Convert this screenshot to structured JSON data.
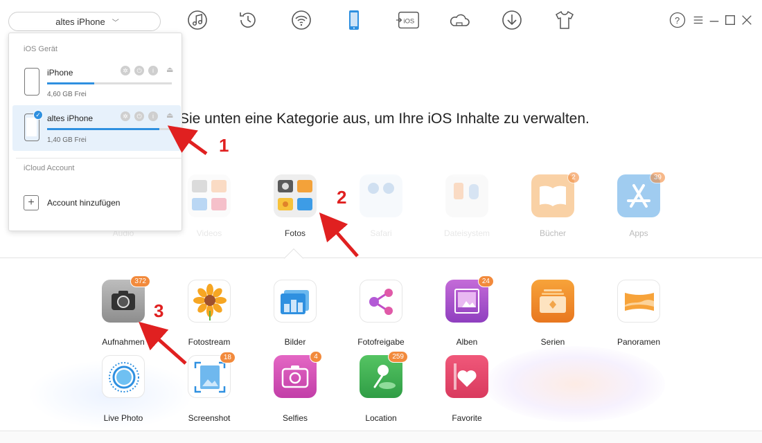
{
  "toolbar": {
    "device_label": "altes iPhone",
    "tools": [
      "music-icon",
      "history-icon",
      "wifi-icon",
      "phone-icon",
      "ios-icon",
      "cloud-icon",
      "download-icon",
      "tshirt-icon"
    ],
    "ios_label": "iOS",
    "active_tool_color": "#2f90e0",
    "help_label": "?"
  },
  "headline": "Sie unten eine Kategorie aus, um Ihre iOS Inhalte zu verwalten.",
  "dropdown": {
    "section_devices": "iOS Gerät",
    "devices": [
      {
        "name": "iPhone",
        "free": "4,60 GB Frei",
        "used_fraction": 0.38,
        "selected": false
      },
      {
        "name": "altes iPhone",
        "free": "1,40 GB Frei",
        "used_fraction": 0.9,
        "selected": true
      }
    ],
    "section_icloud": "iCloud Account",
    "add_account": "Account hinzufügen"
  },
  "categories": [
    {
      "label": "Audio",
      "badge": ""
    },
    {
      "label": "Videos",
      "badge": ""
    },
    {
      "label": "Fotos",
      "badge": "",
      "active": true
    },
    {
      "label": "Safari",
      "badge": ""
    },
    {
      "label": "Dateisystem",
      "badge": ""
    },
    {
      "label": "Bücher",
      "badge": "2"
    },
    {
      "label": "Apps",
      "badge": "39"
    }
  ],
  "photos": [
    {
      "label": "Aufnahmen",
      "badge": "372"
    },
    {
      "label": "Fotostream",
      "badge": ""
    },
    {
      "label": "Bilder",
      "badge": ""
    },
    {
      "label": "Fotofreigabe",
      "badge": ""
    },
    {
      "label": "Alben",
      "badge": "24"
    },
    {
      "label": "Serien",
      "badge": ""
    },
    {
      "label": "Panoramen",
      "badge": ""
    },
    {
      "label": "Live Photo",
      "badge": ""
    },
    {
      "label": "Screenshot",
      "badge": "18"
    },
    {
      "label": "Selfies",
      "badge": "4"
    },
    {
      "label": "Location",
      "badge": "259"
    },
    {
      "label": "Favorite",
      "badge": ""
    }
  ],
  "annotations": [
    "1",
    "2",
    "3"
  ],
  "colors": {
    "accent": "#2f90e0",
    "badge": "#f28a3c",
    "marker": "#e02020"
  }
}
